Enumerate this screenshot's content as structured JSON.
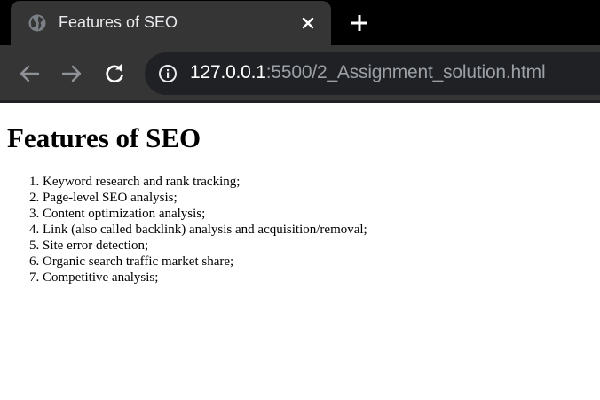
{
  "browser": {
    "tab": {
      "title": "Features of SEO"
    },
    "address_bar": {
      "host": "127.0.0.1",
      "path": ":5500/2_Assignment_solution.html"
    }
  },
  "page": {
    "heading": "Features of SEO",
    "features": [
      "Keyword research and rank tracking;",
      "Page-level SEO analysis;",
      "Content optimization analysis;",
      "Link (also called backlink) analysis and acquisition/removal;",
      "Site error detection;",
      "Organic search traffic market share;",
      "Competitive analysis;"
    ]
  }
}
